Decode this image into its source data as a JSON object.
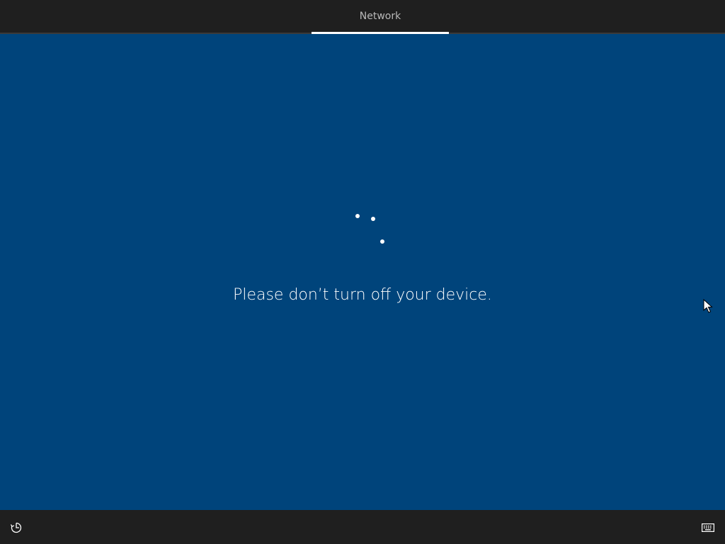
{
  "header": {
    "tabs": [
      {
        "label": "Network",
        "active": true
      }
    ]
  },
  "main": {
    "message": "Please don’t turn off your device.",
    "spinner_icon": "loading-spinner-icon"
  },
  "footer": {
    "left_icon": "ease-of-access-icon",
    "right_icon": "keyboard-icon"
  },
  "colors": {
    "background": "#00447b",
    "bar": "#1f1f1f",
    "text": "#ffffff",
    "tab_text": "#b9b9b9"
  }
}
